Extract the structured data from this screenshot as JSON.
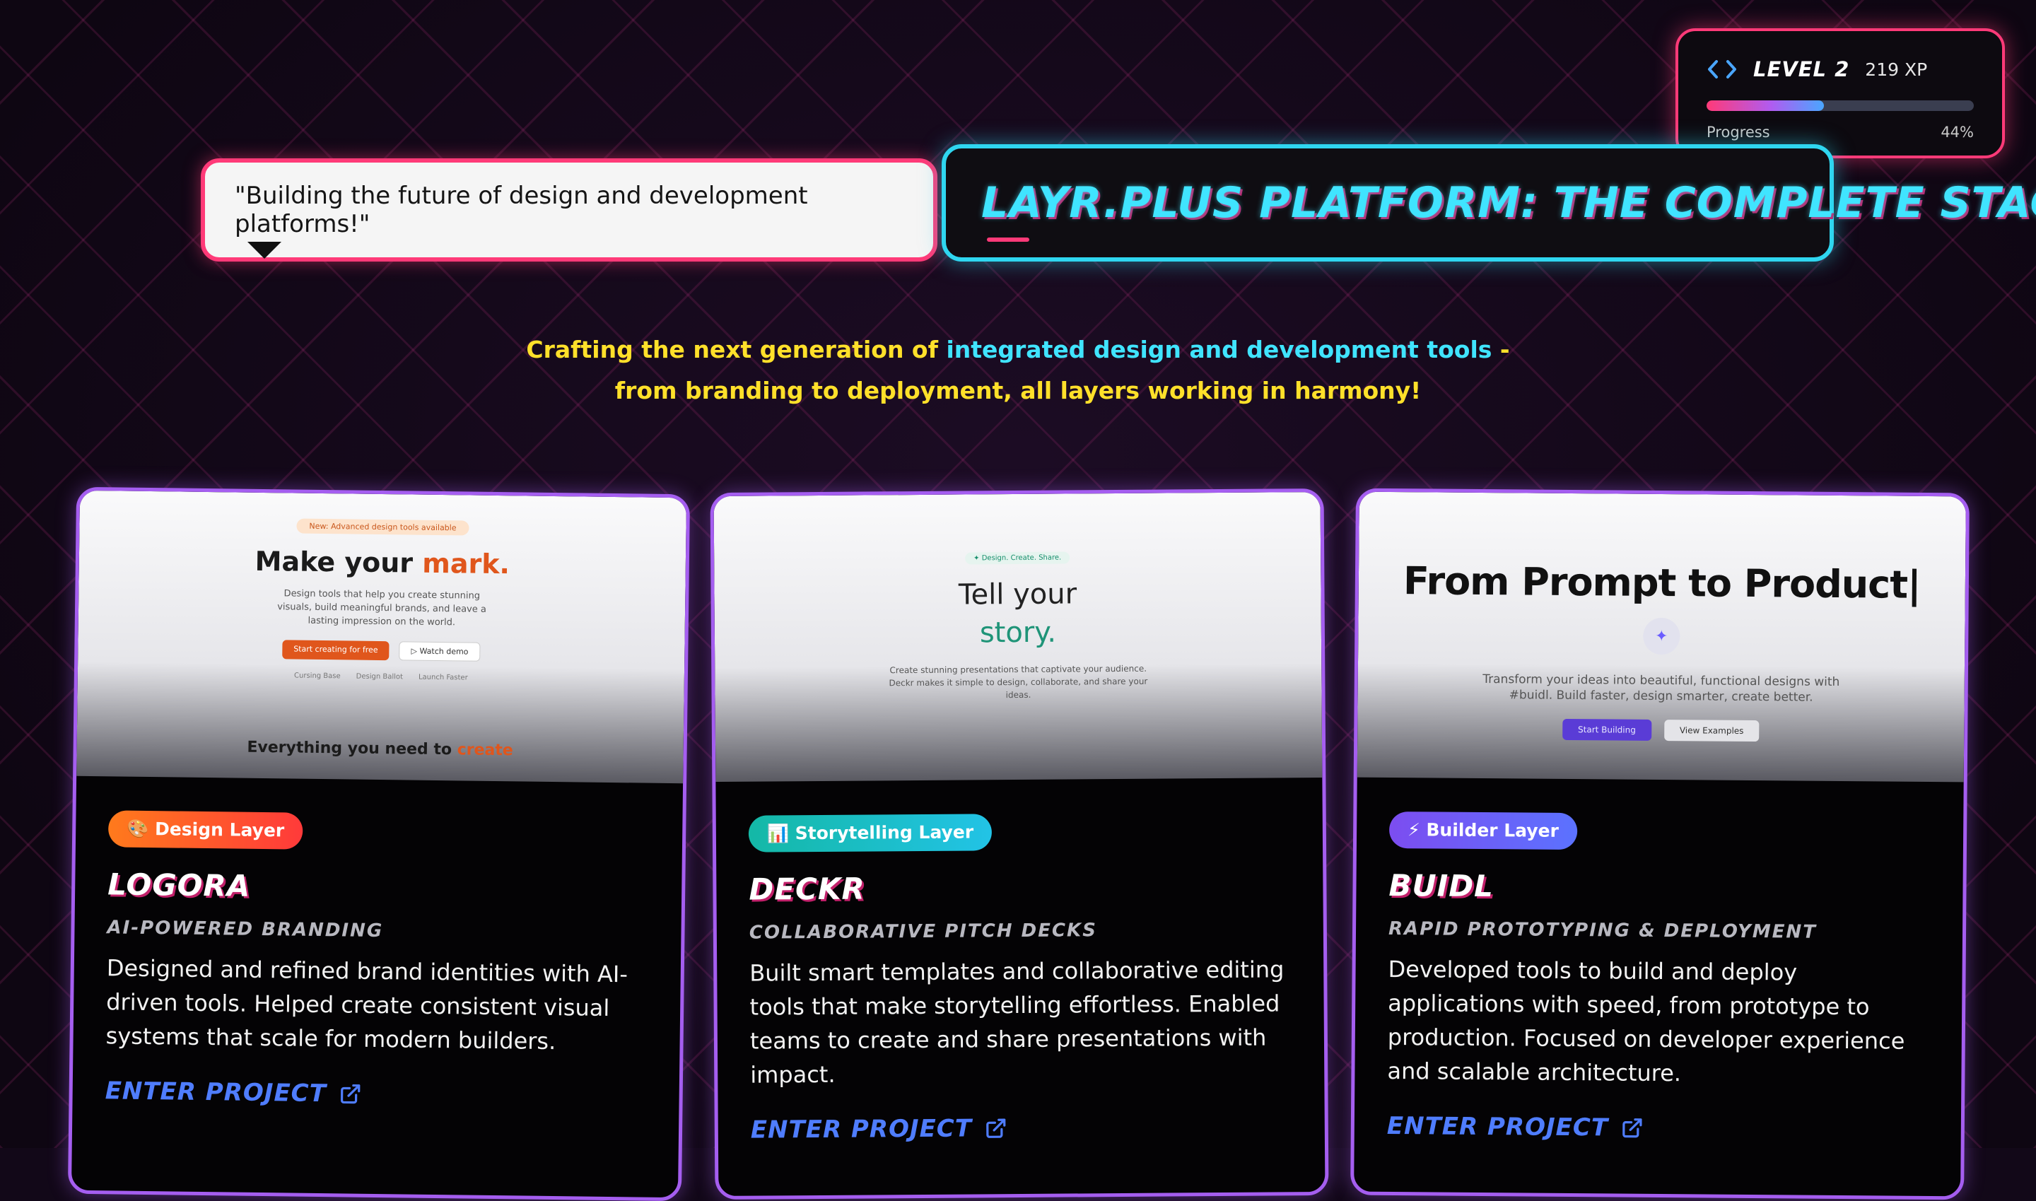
{
  "xp": {
    "level": "LEVEL 2",
    "xp": "219 XP",
    "progress_label": "Progress",
    "progress_text": "44%",
    "progress_value": 0.44
  },
  "quote": "\"Building the future of design and development platforms!\"",
  "headline": "LAYR.PLUS PLATFORM: THE COMPLETE STACK!",
  "tagline": {
    "part1": "Crafting the next generation of ",
    "highlight1": "integrated design",
    "between": " and ",
    "highlight2": "development tools",
    "part2": " - from branding to deployment, all layers working in harmony!"
  },
  "projects": [
    {
      "tag": "🎨 Design Layer",
      "title": "LOGORA",
      "subtitle": "AI-Powered Branding",
      "description": "Designed and refined brand identities with AI-driven tools. Helped create consistent visual systems that scale for modern builders.",
      "link": "Enter Project",
      "preview": {
        "pill": "New: Advanced design tools available",
        "heading": "Make your ",
        "heading_accent": "mark.",
        "text": "Design tools that help you create stunning visuals, build meaningful brands, and leave a lasting impression on the world.",
        "primary_btn": "Start creating for free",
        "secondary_btn": "▷ Watch demo",
        "features": [
          "Cursing Base",
          "Design Ballot",
          "Launch Faster"
        ],
        "subheading": "Everything you need to ",
        "subheading_accent": "create"
      }
    },
    {
      "tag": "📊 Storytelling Layer",
      "title": "DECKR",
      "subtitle": "Collaborative Pitch Decks",
      "description": "Built smart templates and collaborative editing tools that make storytelling effortless. Enabled teams to create and share presentations with impact.",
      "link": "Enter Project",
      "preview": {
        "pill": "✦ Design. Create. Share.",
        "heading": "Tell your",
        "heading_accent": "story.",
        "text": "Create stunning presentations that captivate your audience. Deckr makes it simple to design, collaborate, and share your ideas."
      }
    },
    {
      "tag": "⚡ Builder Layer",
      "title": "BUIDL",
      "subtitle": "Rapid Prototyping & Deployment",
      "description": "Developed tools to build and deploy applications with speed, from prototype to production. Focused on developer experience and scalable architecture.",
      "link": "Enter Project",
      "preview": {
        "heading": "From Prompt to Product|",
        "text": "Transform your ideas into beautiful, functional designs with #buidl. Build faster, design smarter, create better.",
        "primary_btn": "Start Building",
        "secondary_btn": "View Examples"
      }
    }
  ],
  "colors": {
    "pink": "#ff3a78",
    "cyan": "#40e4ff",
    "yellow": "#ffe02a",
    "purple": "#a55ef0",
    "link_blue": "#4f7dff"
  }
}
